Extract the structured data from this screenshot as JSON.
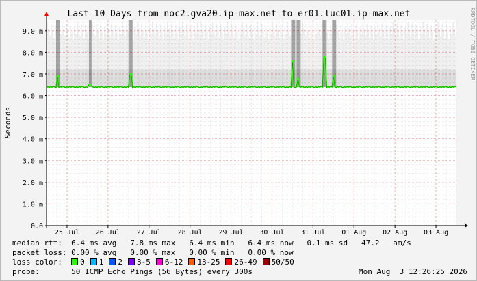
{
  "chart_data": {
    "type": "area",
    "title": "Last 10 Days from noc2.gva20.ip-max.net to er01.luc01.ip-max.net",
    "ylabel": "Seconds",
    "watermark": "RRDTOOL / TOBI OETIKER",
    "y_unit": "m",
    "ylim": [
      0,
      0.0095
    ],
    "y_ticks": [
      "0.0",
      "1.0 m",
      "2.0 m",
      "3.0 m",
      "4.0 m",
      "5.0 m",
      "6.0 m",
      "7.0 m",
      "8.0 m",
      "9.0 m"
    ],
    "x_ticks": [
      "25 Jul",
      "26 Jul",
      "27 Jul",
      "28 Jul",
      "29 Jul",
      "30 Jul",
      "31 Jul",
      "01 Aug",
      "02 Aug",
      "03 Aug"
    ],
    "x_range_days": [
      0,
      10
    ],
    "median_baseline_ms": 6.4,
    "median_spikes": [
      {
        "day": 0.27,
        "value_ms": 6.9
      },
      {
        "day": 1.05,
        "value_ms": 6.5
      },
      {
        "day": 2.05,
        "value_ms": 7.0
      },
      {
        "day": 6.0,
        "value_ms": 7.6
      },
      {
        "day": 6.12,
        "value_ms": 6.8
      },
      {
        "day": 6.78,
        "value_ms": 7.8
      },
      {
        "day": 7.0,
        "value_ms": 6.9
      }
    ],
    "smoke_top_ms": 9.4,
    "grid": true
  },
  "stats": {
    "rtt_label": "median rtt:",
    "rtt_values": "6.4 ms avg   7.8 ms max   6.4 ms min   6.4 ms now   0.1 ms sd   47.2   am/s",
    "loss_label": "packet loss:",
    "loss_values": "0.00 % avg   0.00 % max   0.00 % min   0.00 % now",
    "color_label": "loss color:",
    "loss_colors": [
      {
        "label": "0",
        "color": "#26ff00"
      },
      {
        "label": "1",
        "color": "#00b8ff"
      },
      {
        "label": "2",
        "color": "#0059ff"
      },
      {
        "label": "3-5",
        "color": "#7e00ff"
      },
      {
        "label": "6-12",
        "color": "#ff00d0"
      },
      {
        "label": "13-25",
        "color": "#ff5e00"
      },
      {
        "label": "26-49",
        "color": "#ff0000"
      },
      {
        "label": "50/50",
        "color": "#a10000"
      }
    ],
    "probe_label": "probe:",
    "probe_value": "50 ICMP Echo Pings (56 Bytes) every 300s",
    "timestamp": "Mon Aug  3 12:26:25 2026"
  }
}
